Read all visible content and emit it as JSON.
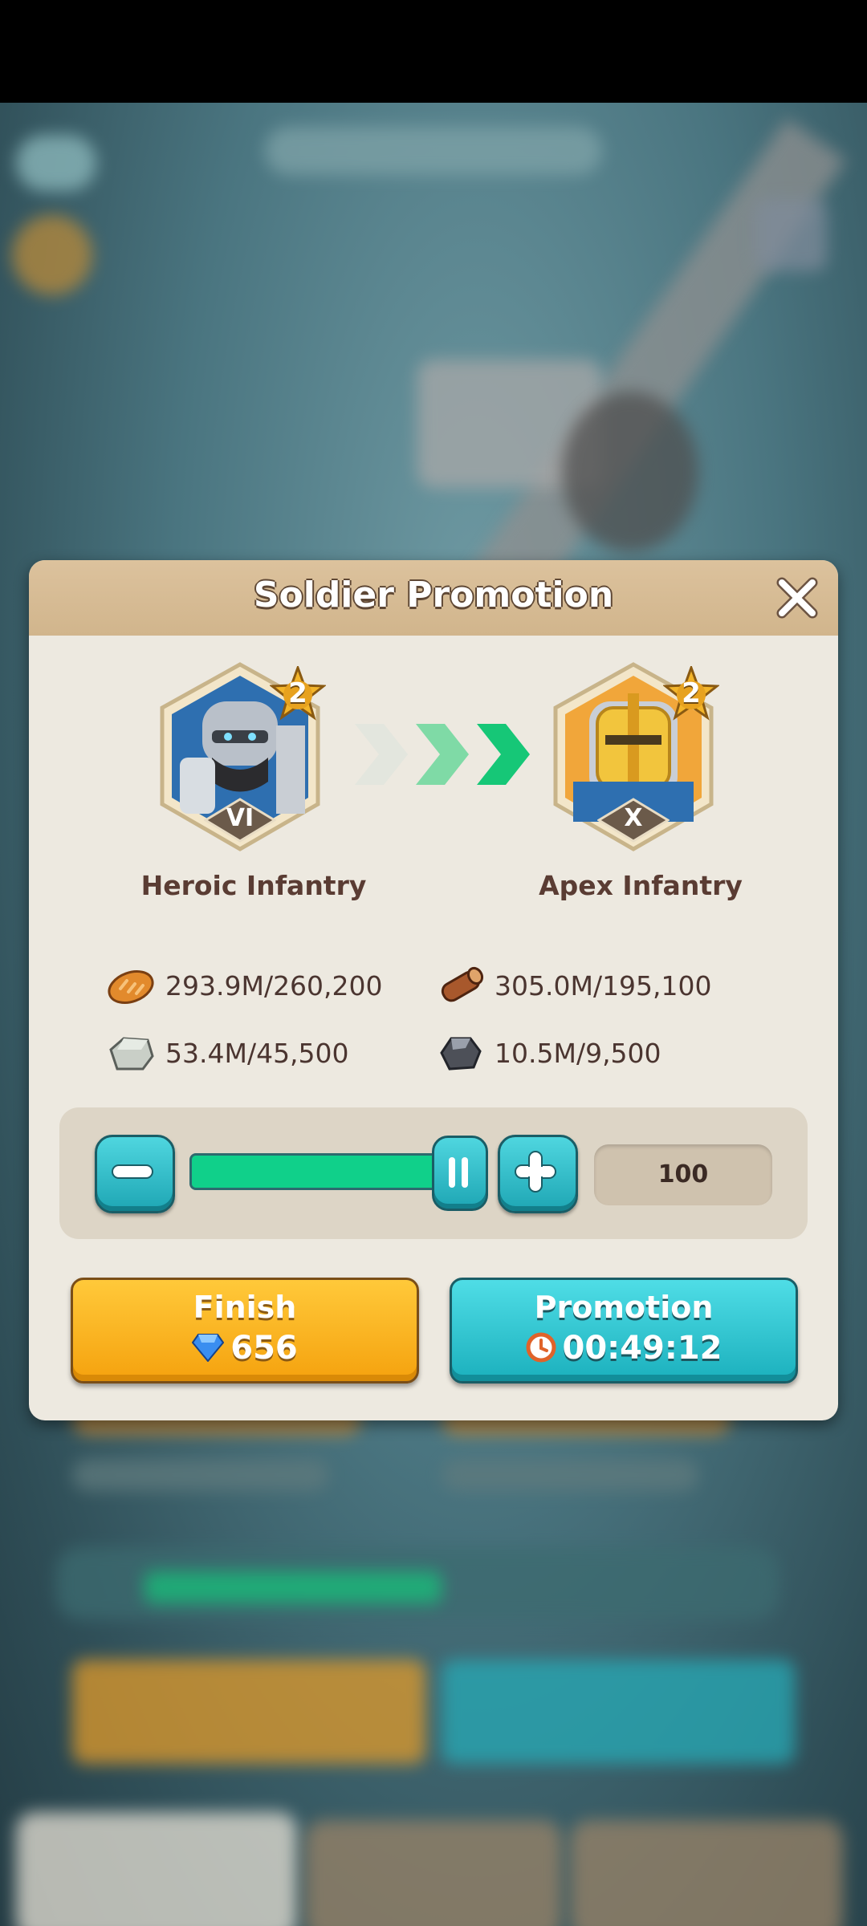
{
  "dialog": {
    "title": "Soldier Promotion",
    "from_unit": {
      "name": "Heroic Infantry",
      "rank": "VI",
      "star": "2"
    },
    "to_unit": {
      "name": "Apex Infantry",
      "rank": "X",
      "star": "2"
    },
    "resources": [
      {
        "icon": "bread-icon",
        "text": "293.9M/260,200"
      },
      {
        "icon": "wood-log-icon",
        "text": "305.0M/195,100"
      },
      {
        "icon": "stone-icon",
        "text": "53.4M/45,500"
      },
      {
        "icon": "iron-ore-icon",
        "text": "10.5M/9,500"
      }
    ],
    "quantity": "100",
    "slider_fill": 1.0,
    "finish": {
      "label": "Finish",
      "cost": "656"
    },
    "promotion": {
      "label": "Promotion",
      "time": "00:49:12"
    }
  },
  "colors": {
    "accent_green": "#10d08a",
    "teal": "#1ea6b4",
    "orange": "#f5a20e",
    "header": "#d1b58c"
  }
}
